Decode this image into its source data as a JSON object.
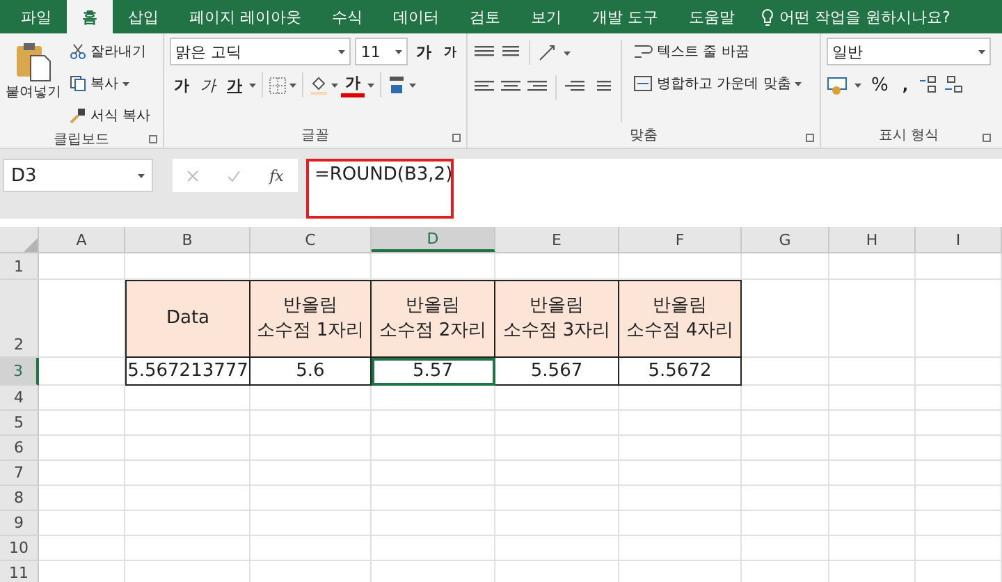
{
  "tabs": [
    {
      "label": "파일",
      "selected": false
    },
    {
      "label": "홈",
      "selected": true
    },
    {
      "label": "삽입",
      "selected": false
    },
    {
      "label": "페이지 레이아웃",
      "selected": false
    },
    {
      "label": "수식",
      "selected": false
    },
    {
      "label": "데이터",
      "selected": false
    },
    {
      "label": "검토",
      "selected": false
    },
    {
      "label": "보기",
      "selected": false
    },
    {
      "label": "개발 도구",
      "selected": false
    },
    {
      "label": "도움말",
      "selected": false
    }
  ],
  "tell_me": "어떤 작업을 원하시나요?",
  "ribbon": {
    "clipboard": {
      "paste": "붙여넣기",
      "cut": "잘라내기",
      "copy": "복사",
      "format_painter": "서식 복사",
      "label": "클립보드"
    },
    "font": {
      "name": "맑은 고딕",
      "size": "11",
      "grow": "가",
      "shrink": "가",
      "bold": "가",
      "italic": "가",
      "underline": "가",
      "font_color": "가",
      "label": "글꼴"
    },
    "alignment": {
      "wrap": "텍스트 줄 바꿈",
      "merge": "병합하고 가운데 맞춤",
      "label": "맞춤"
    },
    "number": {
      "format": "일반",
      "percent": "%",
      "comma": ",",
      "label": "표시 형식"
    }
  },
  "formula_bar": {
    "name_box": "D3",
    "fx": "fx",
    "formula": "=ROUND(B3,2)",
    "highlighted": true
  },
  "columns": [
    {
      "label": "A",
      "selected": false
    },
    {
      "label": "B",
      "selected": false
    },
    {
      "label": "C",
      "selected": false
    },
    {
      "label": "D",
      "selected": true
    },
    {
      "label": "E",
      "selected": false
    },
    {
      "label": "F",
      "selected": false
    },
    {
      "label": "G",
      "selected": false
    },
    {
      "label": "H",
      "selected": false
    },
    {
      "label": "I",
      "selected": false
    }
  ],
  "rows": [
    {
      "label": "1",
      "selected": false
    },
    {
      "label": "2",
      "selected": false
    },
    {
      "label": "3",
      "selected": true
    },
    {
      "label": "4",
      "selected": false
    },
    {
      "label": "5",
      "selected": false
    },
    {
      "label": "6",
      "selected": false
    },
    {
      "label": "7",
      "selected": false
    },
    {
      "label": "8",
      "selected": false
    },
    {
      "label": "9",
      "selected": false
    },
    {
      "label": "10",
      "selected": false
    },
    {
      "label": "11",
      "selected": false
    }
  ],
  "table": {
    "header": [
      {
        "lines": [
          "Data"
        ]
      },
      {
        "lines": [
          "반올림",
          "소수점 1자리"
        ]
      },
      {
        "lines": [
          "반올림",
          "소수점 2자리"
        ]
      },
      {
        "lines": [
          "반올림",
          "소수점 3자리"
        ]
      },
      {
        "lines": [
          "반올림",
          "소수점 4자리"
        ]
      }
    ],
    "values": [
      {
        "text": "5.567213777",
        "selected": false
      },
      {
        "text": "5.6",
        "selected": false
      },
      {
        "text": "5.57",
        "selected": true
      },
      {
        "text": "5.567",
        "selected": false
      },
      {
        "text": "5.5672",
        "selected": false
      }
    ]
  }
}
